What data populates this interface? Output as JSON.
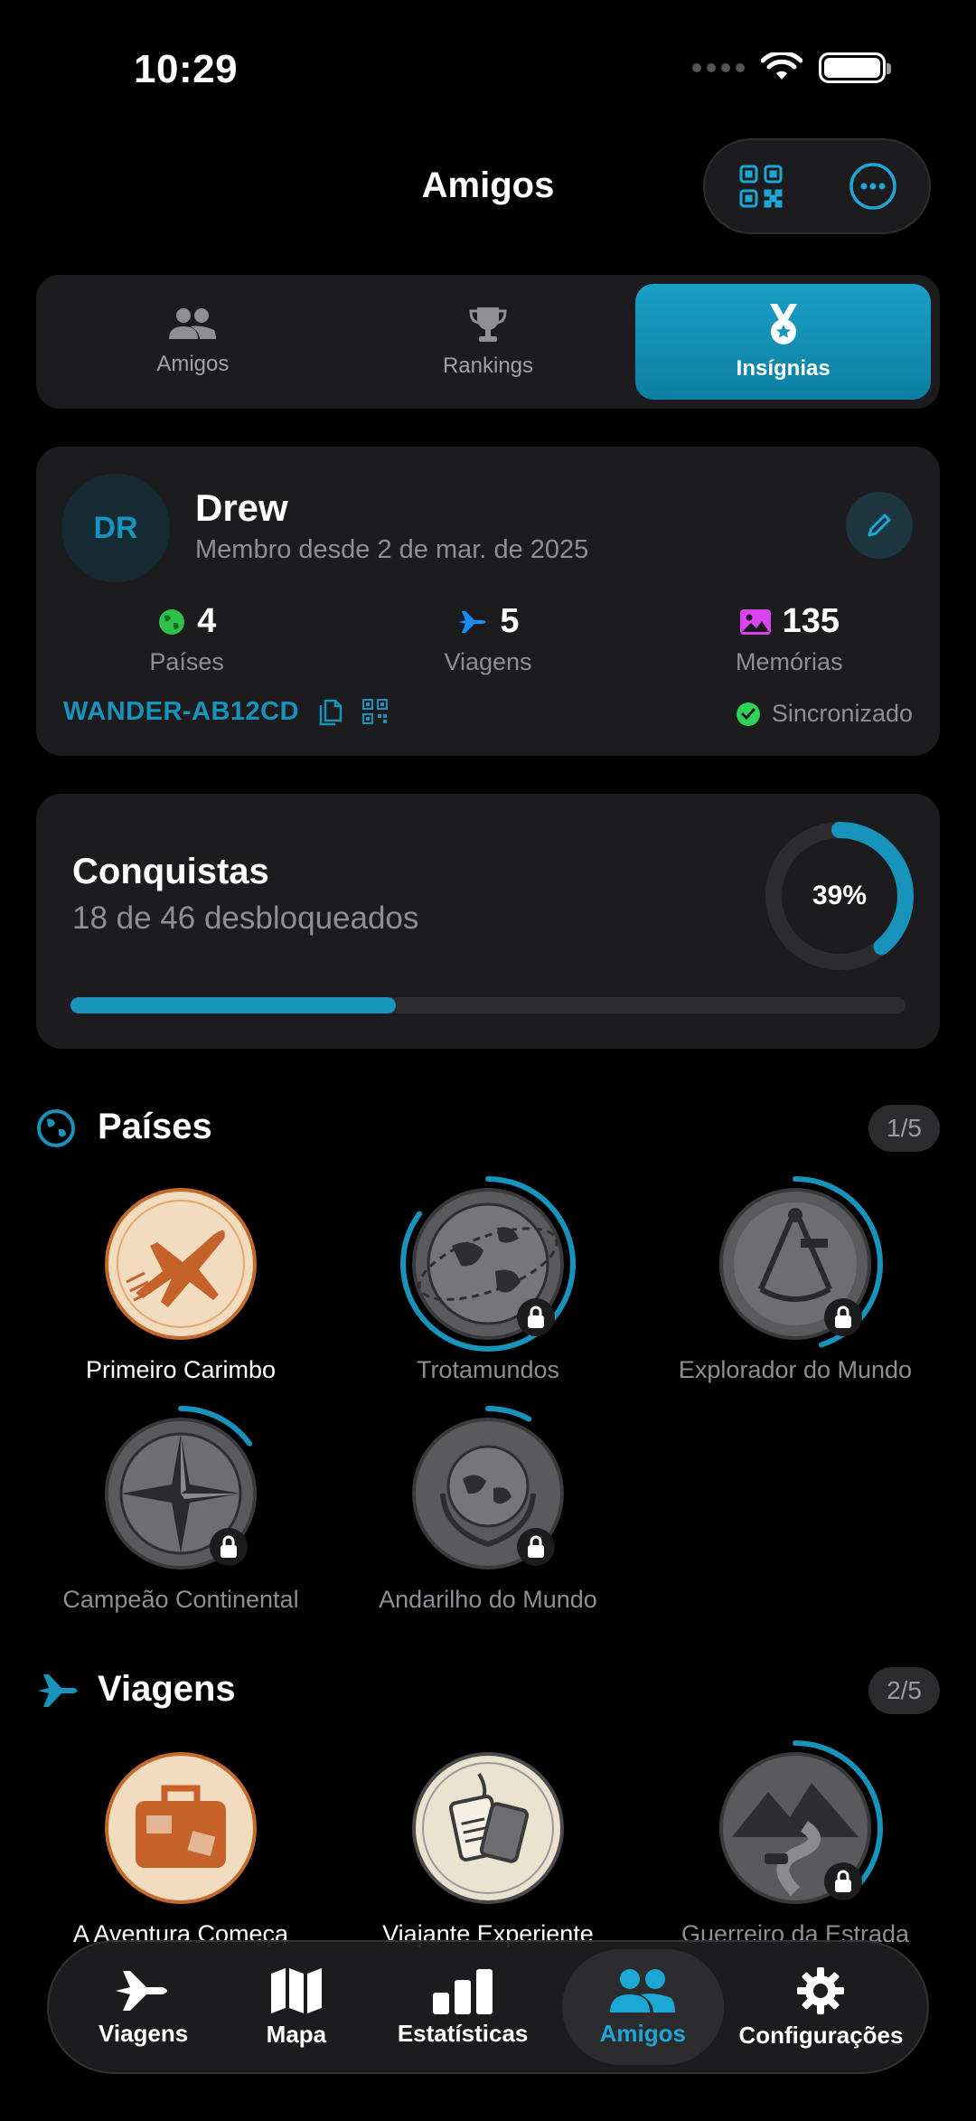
{
  "status_bar": {
    "time": "10:29"
  },
  "header": {
    "title": "Amigos"
  },
  "segments": [
    {
      "label": "Amigos",
      "icon": "people-icon",
      "active": false
    },
    {
      "label": "Rankings",
      "icon": "trophy-icon",
      "active": false
    },
    {
      "label": "Insígnias",
      "icon": "medal-icon",
      "active": true
    }
  ],
  "profile": {
    "initials": "DR",
    "name": "Drew",
    "member_since": "Membro desde 2 de mar. de 2025",
    "stats": [
      {
        "value": "4",
        "label": "Países",
        "icon": "globe-icon"
      },
      {
        "value": "5",
        "label": "Viagens",
        "icon": "airplane-icon"
      },
      {
        "value": "135",
        "label": "Memórias",
        "icon": "photo-icon"
      }
    ],
    "friend_code": "WANDER-AB12CD",
    "sync_status": "Sincronizado"
  },
  "achievements": {
    "title": "Conquistas",
    "subtitle": "18 de 46 desbloqueados",
    "percent_label": "39%",
    "progress": 0.39
  },
  "sections": {
    "countries": {
      "title": "Países",
      "count": "1/5",
      "badges": [
        {
          "label": "Primeiro Carimbo",
          "locked": false,
          "progress": 1.0,
          "icon": "airplane-stamp-icon"
        },
        {
          "label": "Trotamundos",
          "locked": true,
          "progress": 0.85,
          "icon": "globe-route-icon"
        },
        {
          "label": "Explorador do Mundo",
          "locked": true,
          "progress": 0.45,
          "icon": "sextant-icon"
        },
        {
          "label": "Campeão Continental",
          "locked": true,
          "progress": 0.15,
          "icon": "compass-rose-icon"
        },
        {
          "label": "Andarilho do Mundo",
          "locked": true,
          "progress": 0.08,
          "icon": "laurel-globe-icon"
        }
      ]
    },
    "trips": {
      "title": "Viagens",
      "count": "2/5",
      "badges": [
        {
          "label": "A Aventura Começa",
          "locked": false,
          "progress": 1.0,
          "icon": "suitcase-icon"
        },
        {
          "label": "Viajante Experiente",
          "locked": false,
          "progress": 1.0,
          "icon": "luggage-tags-icon"
        },
        {
          "label": "Guerreiro da Estrada",
          "locked": true,
          "progress": 0.4,
          "icon": "mountain-road-icon"
        }
      ]
    }
  },
  "tabbar": [
    {
      "label": "Viagens",
      "icon": "airplane-icon",
      "active": false
    },
    {
      "label": "Mapa",
      "icon": "map-icon",
      "active": false
    },
    {
      "label": "Estatísticas",
      "icon": "bar-chart-icon",
      "active": false
    },
    {
      "label": "Amigos",
      "icon": "people-icon",
      "active": true
    },
    {
      "label": "Configurações",
      "icon": "gear-icon",
      "active": false
    }
  ],
  "colors": {
    "accent": "#1793bc",
    "background": "#000000",
    "card": "#1c1c1e"
  }
}
